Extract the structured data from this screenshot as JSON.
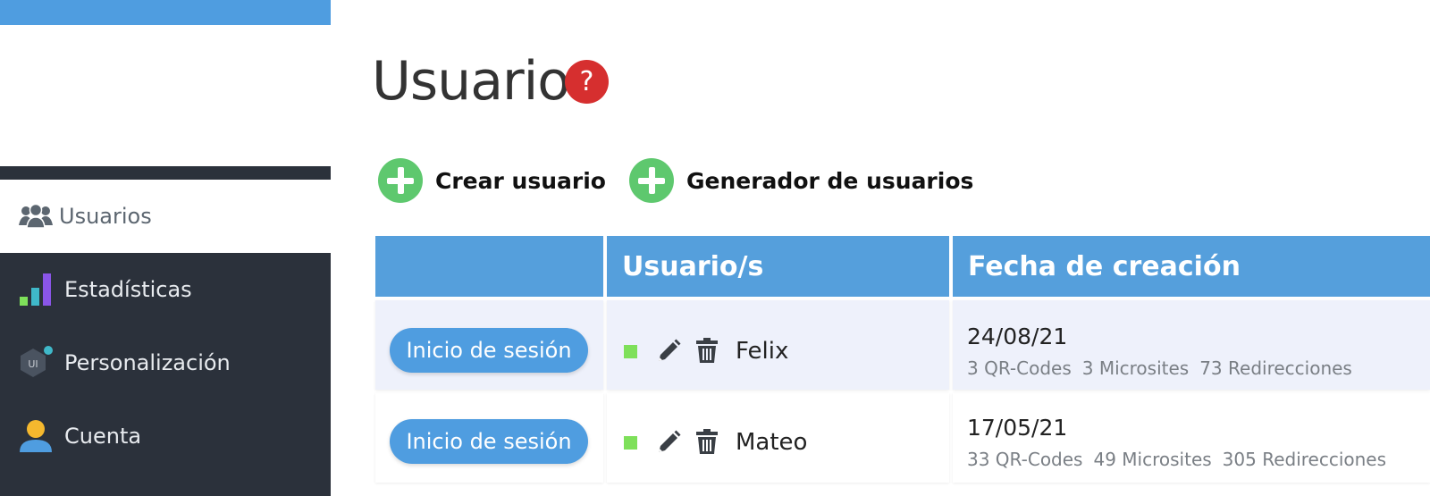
{
  "sidebar": {
    "items": [
      {
        "label": "Usuarios",
        "icon": "users-icon",
        "active": true
      },
      {
        "label": "Estadísticas",
        "icon": "bar-chart-icon",
        "active": false
      },
      {
        "label": "Personalización",
        "icon": "ui-hexagon-icon",
        "active": false
      },
      {
        "label": "Cuenta",
        "icon": "user-icon",
        "active": false
      }
    ],
    "ui_badge": "UI"
  },
  "page": {
    "title": "Usuario",
    "help_symbol": "?"
  },
  "actions": {
    "create_user": "Crear usuario",
    "user_generator": "Generador de usuarios"
  },
  "table": {
    "headers": [
      "",
      "Usuario/s",
      "Fecha de creación"
    ],
    "rows": [
      {
        "login_label": "Inicio de sesión",
        "status_color": "#7ee05a",
        "name": "Felix",
        "date": "24/08/21",
        "qr": "3 QR-Codes",
        "microsites": "3 Microsites",
        "redirects": "73 Redirecciones"
      },
      {
        "login_label": "Inicio de sesión",
        "status_color": "#7ee05a",
        "name": "Mateo",
        "date": "17/05/21",
        "qr": "33 QR-Codes",
        "microsites": "49 Microsites",
        "redirects": "305 Redirecciones"
      }
    ]
  },
  "colors": {
    "accent_blue": "#4f9de0",
    "header_blue": "#559fdc",
    "sidebar_dark": "#2b313b",
    "help_red": "#d62f2f",
    "plus_green": "#5ec86e"
  }
}
